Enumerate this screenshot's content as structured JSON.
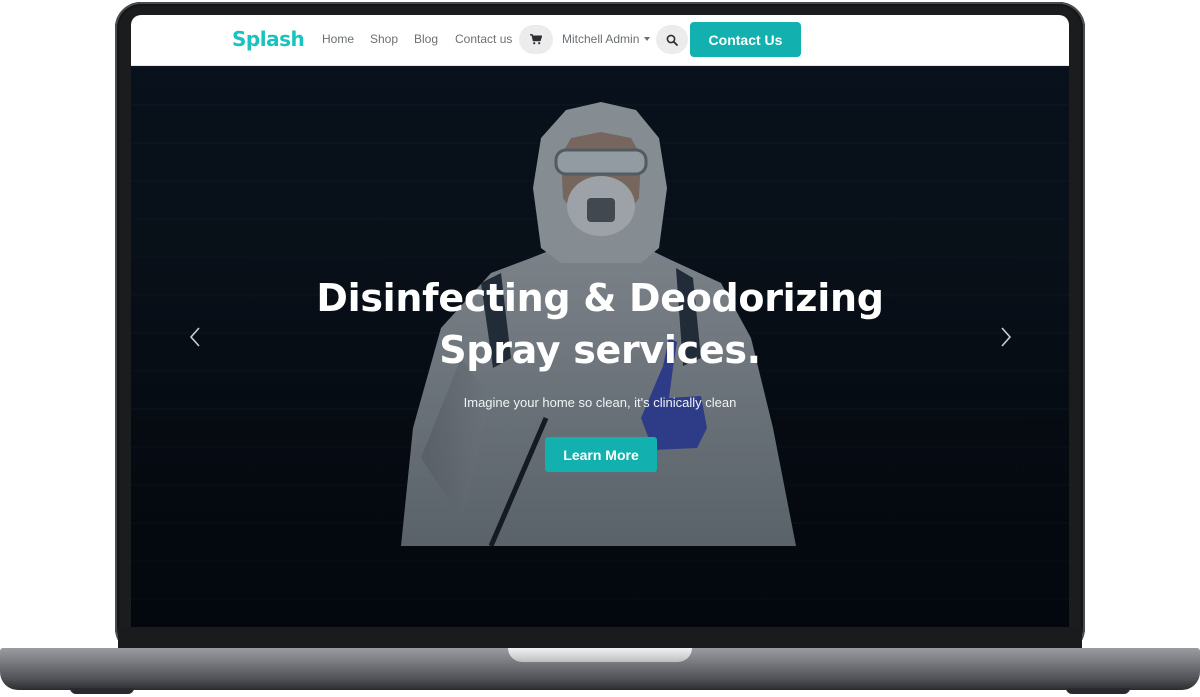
{
  "brand": {
    "logo_text": "Splash",
    "accent": "#12b0ae",
    "logo_color": "#19c3c0"
  },
  "nav": {
    "links": [
      "Home",
      "Shop",
      "Blog",
      "Contact us"
    ],
    "cart_icon": "shopping-cart-icon",
    "user": "Mitchell Admin",
    "search_icon": "search-icon",
    "cta_label": "Contact Us"
  },
  "hero": {
    "title_line1": "Disinfecting & Deodorizing",
    "title_line2": "Spray services.",
    "subtitle": "Imagine your home so clean, it's clinically clean",
    "button_label": "Learn More",
    "prev_icon": "chevron-left-icon",
    "next_icon": "chevron-right-icon"
  }
}
